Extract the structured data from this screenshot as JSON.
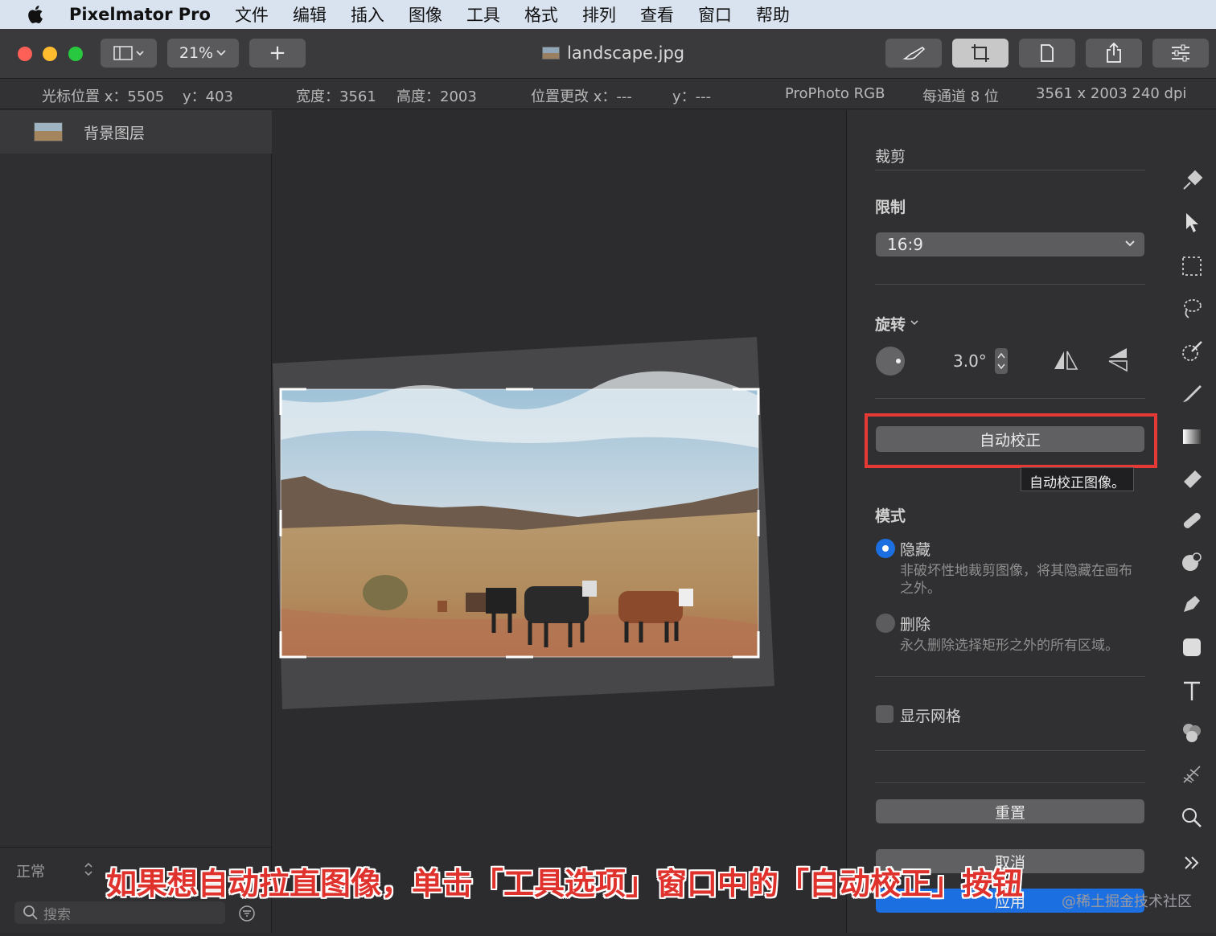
{
  "menubar": {
    "app_name": "Pixelmator Pro",
    "items": [
      "文件",
      "编辑",
      "插入",
      "图像",
      "工具",
      "格式",
      "排列",
      "查看",
      "窗口",
      "帮助"
    ]
  },
  "toolbar": {
    "zoom": "21%",
    "add": "+",
    "doc_title": "landscape.jpg"
  },
  "infobar": {
    "cursor_x": "光标位置 x：5505",
    "cursor_y": "y：403",
    "width": "宽度：3561",
    "height": "高度：2003",
    "pos_x": "位置更改 x：---",
    "pos_y": "y：---",
    "color_profile": "ProPhoto RGB",
    "depth": "每通道 8 位",
    "size": "3561 x 2003 240 dpi"
  },
  "layers": {
    "items": [
      "背景图层"
    ],
    "blend_mode": "正常",
    "search_placeholder": "搜索"
  },
  "crop_panel": {
    "title": "裁剪",
    "constraint_label": "限制",
    "constraint_value": "16:9",
    "rotate_label": "旋转",
    "rotate_value": "3.0°",
    "auto_straighten": "自动校正",
    "auto_tooltip": "自动校正图像。",
    "mode_label": "模式",
    "mode_hide": "隐藏",
    "mode_hide_desc": "非破坏性地裁剪图像，将其隐藏在画布之外。",
    "mode_delete": "删除",
    "mode_delete_desc": "永久删除选择矩形之外的所有区域。",
    "show_grid": "显示网格",
    "reset": "重置",
    "cancel": "取消",
    "apply": "应用"
  },
  "overlay": {
    "caption": "如果想自动拉直图像，单击「工具选项」窗口中的「自动校正」按钮",
    "watermark": "@稀土掘金技术社区"
  },
  "colors": {
    "accent": "#1b6fe0",
    "highlight": "#e53935"
  }
}
